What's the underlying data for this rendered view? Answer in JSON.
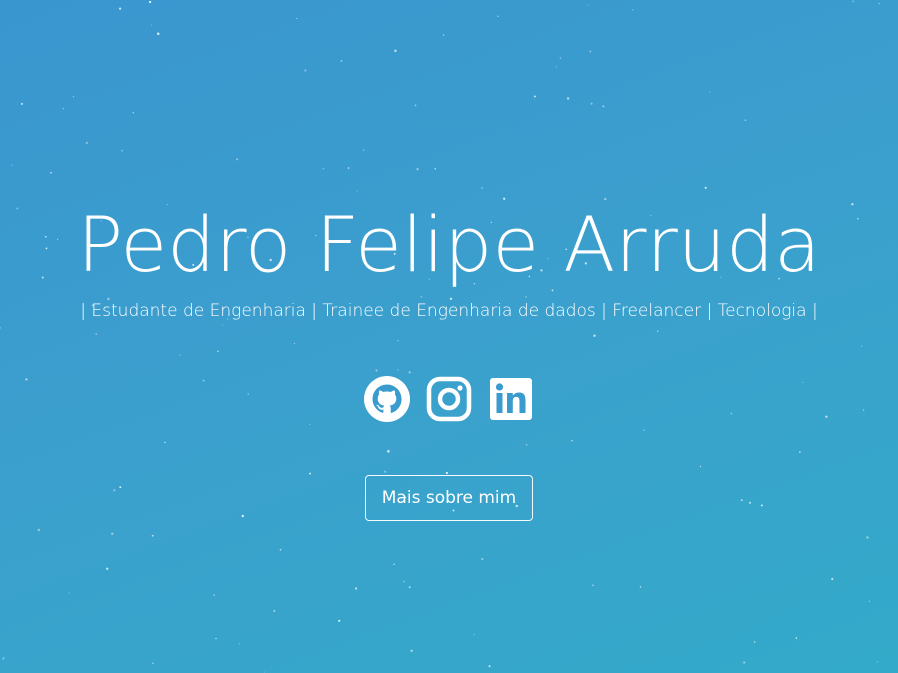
{
  "hero": {
    "name": "Pedro Felipe Arruda",
    "tagline": "| Estudante de Engenharia | Trainee de Engenharia de dados | Freelancer | Tecnologia |",
    "socials": [
      {
        "icon": "github-icon"
      },
      {
        "icon": "instagram-icon"
      },
      {
        "icon": "linkedin-icon"
      }
    ],
    "cta_label": "Mais sobre mim"
  },
  "colors": {
    "background_start": "#3a96cf",
    "background_end": "#33aac9",
    "text": "#ffffff"
  }
}
